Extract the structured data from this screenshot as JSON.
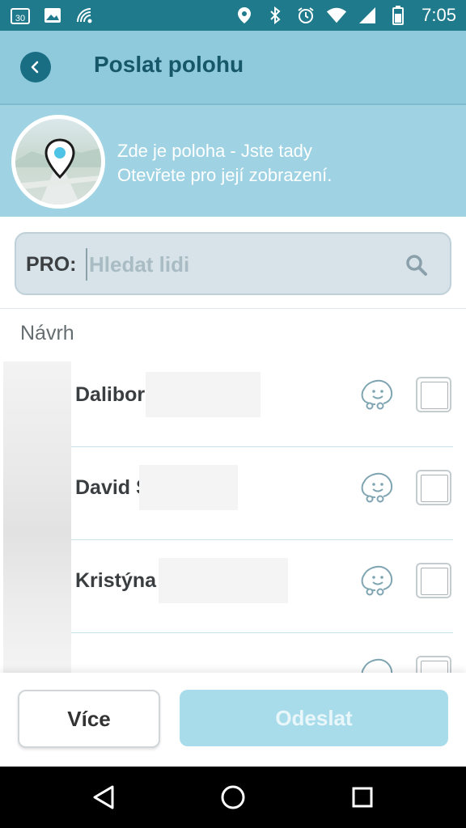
{
  "status_bar": {
    "time": "7:05",
    "calendar_day": "30",
    "icons": [
      "calendar-icon",
      "image-icon",
      "wifi-signal-icon",
      "location-icon",
      "bluetooth-icon",
      "alarm-icon",
      "wifi-icon",
      "cell-signal-icon",
      "battery-icon"
    ]
  },
  "header": {
    "title": "Poslat polohu",
    "back_icon": "chevron-left-icon"
  },
  "location": {
    "line1": "Zde je poloha - Jste tady",
    "line2": "Otevřete pro její zobrazení."
  },
  "search": {
    "label": "PRO:",
    "placeholder": "Hledat lidi",
    "icon": "search-icon"
  },
  "suggestions": {
    "section_label": "Návrh",
    "contacts": [
      {
        "name": "Dalibor"
      },
      {
        "name": "David S"
      },
      {
        "name": "Kristýna"
      }
    ]
  },
  "actions": {
    "more_label": "Více",
    "send_label": "Odeslat"
  },
  "colors": {
    "status_bar": "#1f7a8c",
    "header": "#8ec9dc",
    "banner": "#9fd3e3",
    "title": "#17576a",
    "send_button": "#a9dcea"
  }
}
